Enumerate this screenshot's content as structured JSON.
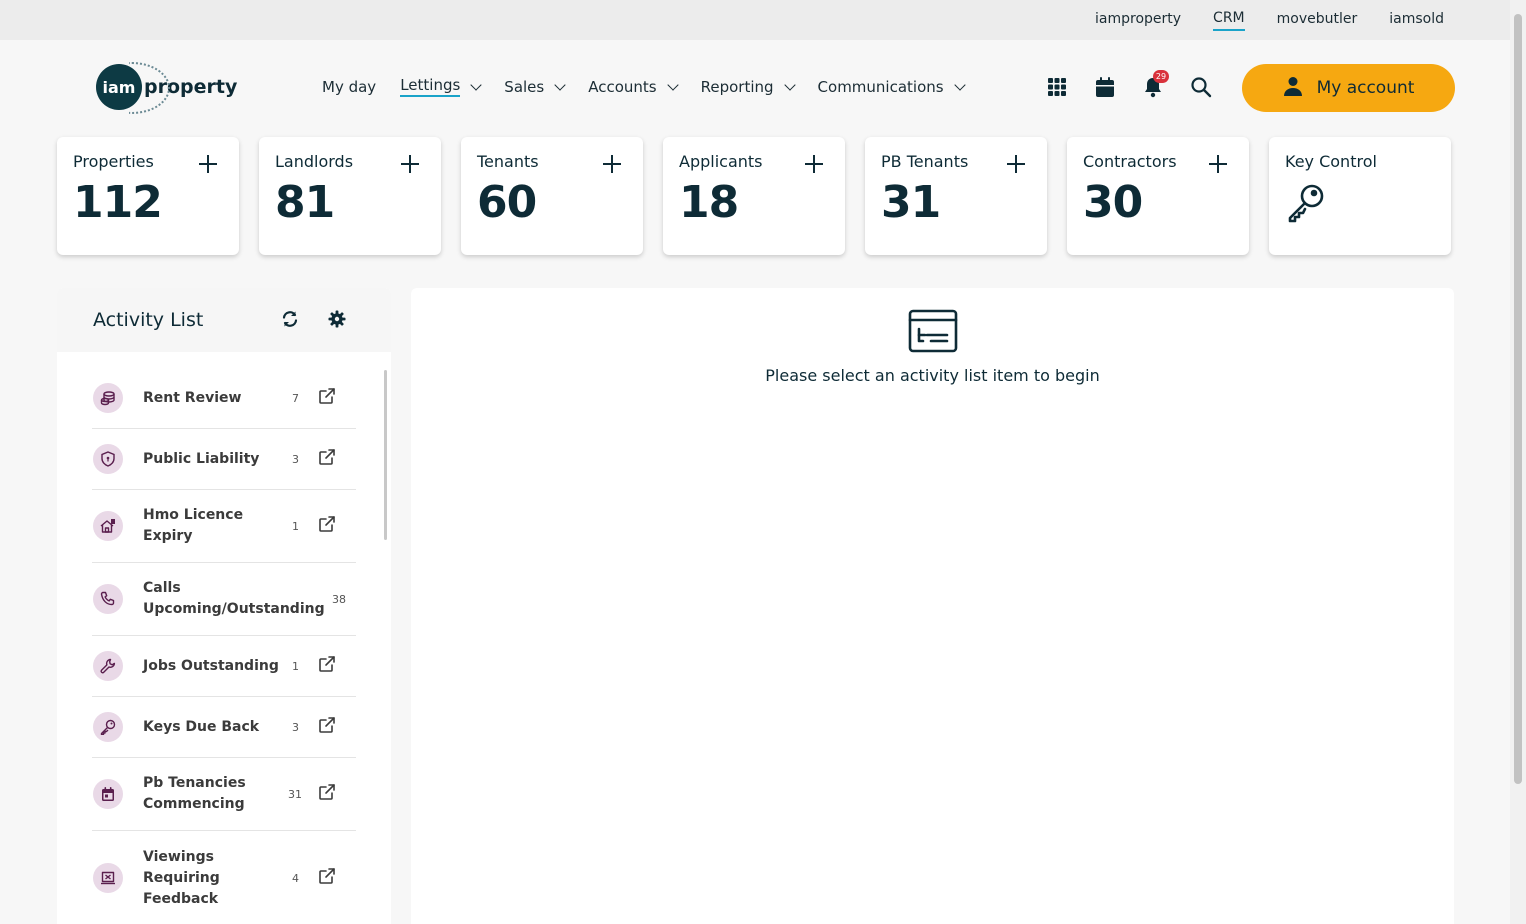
{
  "top_links": [
    {
      "label": "iamproperty",
      "active": false
    },
    {
      "label": "CRM",
      "active": true
    },
    {
      "label": "movebutler",
      "active": false
    },
    {
      "label": "iamsold",
      "active": false
    }
  ],
  "logo": {
    "circle_text": "iam",
    "word": "property"
  },
  "nav": [
    {
      "label": "My day",
      "dropdown": false,
      "active": false
    },
    {
      "label": "Lettings",
      "dropdown": true,
      "active": true
    },
    {
      "label": "Sales",
      "dropdown": true,
      "active": false
    },
    {
      "label": "Accounts",
      "dropdown": true,
      "active": false
    },
    {
      "label": "Reporting",
      "dropdown": true,
      "active": false
    },
    {
      "label": "Communications",
      "dropdown": true,
      "active": false
    }
  ],
  "header_icons": {
    "apps": "grid-icon",
    "calendar": "calendar-icon",
    "notifications": "bell-icon",
    "notification_count": "29",
    "search": "search-icon"
  },
  "account_button": {
    "label": "My account",
    "icon": "user-icon"
  },
  "stats": [
    {
      "title": "Properties",
      "value": "112"
    },
    {
      "title": "Landlords",
      "value": "81"
    },
    {
      "title": "Tenants",
      "value": "60"
    },
    {
      "title": "Applicants",
      "value": "18"
    },
    {
      "title": "PB Tenants",
      "value": "31"
    },
    {
      "title": "Contractors",
      "value": "30"
    }
  ],
  "key_control": {
    "title": "Key Control",
    "icon": "key-icon"
  },
  "activity": {
    "title": "Activity List",
    "items": [
      {
        "label": "Rent Review",
        "count": "7",
        "icon": "coins-icon",
        "external": true
      },
      {
        "label": "Public Liability",
        "count": "3",
        "icon": "shield-icon",
        "external": true
      },
      {
        "label": "Hmo Licence Expiry",
        "count": "1",
        "icon": "house-icon",
        "external": true
      },
      {
        "label": "Calls Upcoming/Outstanding",
        "count": "38",
        "icon": "phone-icon",
        "external": false
      },
      {
        "label": "Jobs Outstanding",
        "count": "1",
        "icon": "wrench-icon",
        "external": true
      },
      {
        "label": "Keys Due Back",
        "count": "3",
        "icon": "key-icon",
        "external": true
      },
      {
        "label": "Pb Tenancies Commencing",
        "count": "31",
        "icon": "calendar-icon",
        "external": true
      },
      {
        "label": "Viewings Requiring Feedback",
        "count": "4",
        "icon": "feedback-icon",
        "external": true
      }
    ]
  },
  "main": {
    "empty_message": "Please select an activity list item to begin"
  },
  "colors": {
    "accent": "#f6a811",
    "brand": "#0d3a44",
    "link_underline": "#1aa3c9",
    "icon_bg": "#e9d9e7",
    "badge": "#d9323c"
  }
}
